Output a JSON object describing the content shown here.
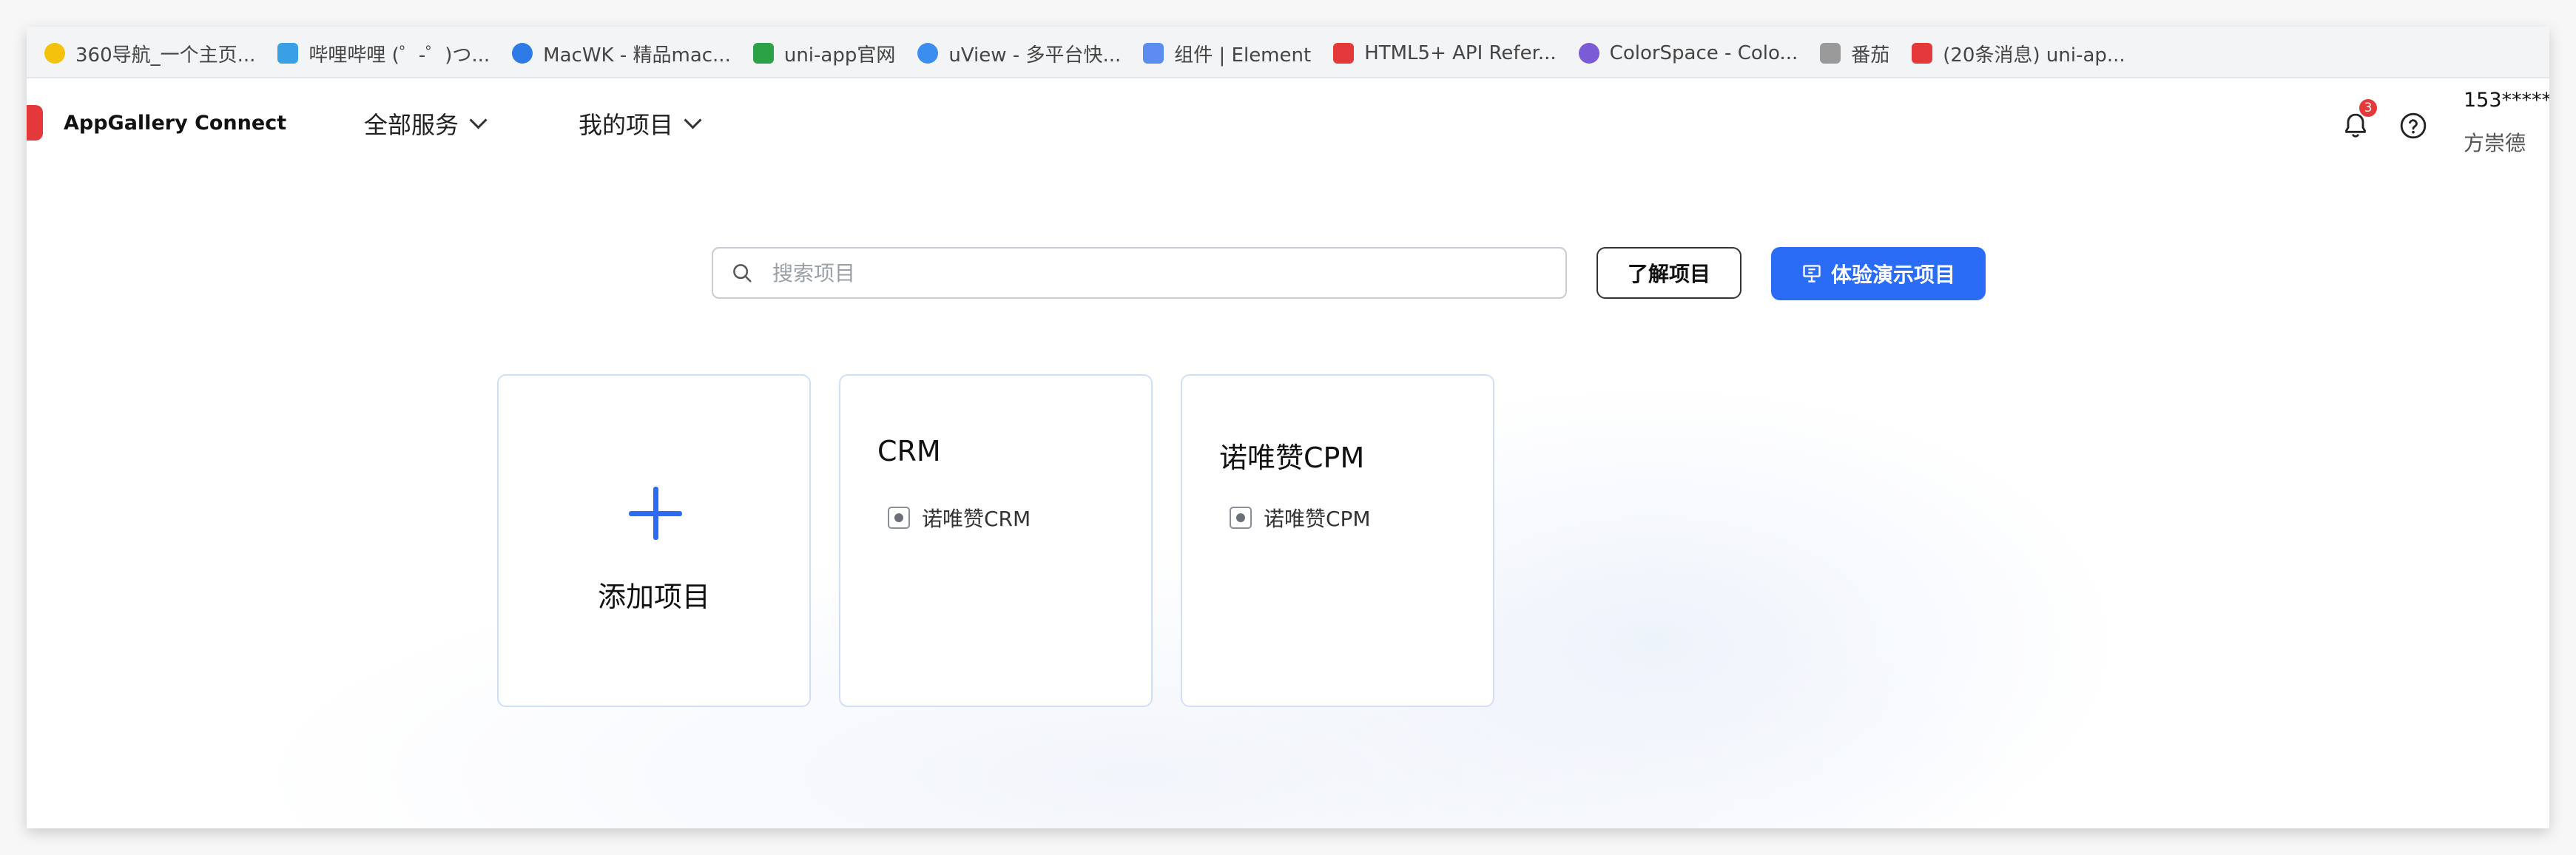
{
  "bookmarks": [
    {
      "label": "360导航_一个主页...",
      "color": "#f4c20d"
    },
    {
      "label": "哔哩哔哩 (゜-゜)つ...",
      "color": "#3aa0e6"
    },
    {
      "label": "MacWK - 精品mac...",
      "color": "#2e7be8"
    },
    {
      "label": "uni-app官网",
      "color": "#2ba245"
    },
    {
      "label": "uView - 多平台快...",
      "color": "#3b8df0"
    },
    {
      "label": "组件 | Element",
      "color": "#5b8def"
    },
    {
      "label": "HTML5+ API Refer...",
      "color": "#e5383b"
    },
    {
      "label": "ColorSpace - Colo...",
      "color": "#7b5bd6"
    },
    {
      "label": "番茄",
      "color": "#9a9a9a"
    },
    {
      "label": "(20条消息) uni-ap...",
      "color": "#e5383b"
    }
  ],
  "header": {
    "brand": "AppGallery Connect",
    "nav_all_services": "全部服务",
    "nav_my_projects": "我的项目",
    "notification_count": "3",
    "user_phone": "153*****",
    "user_name": "方崇德"
  },
  "toolbar": {
    "search_placeholder": "搜索项目",
    "learn_label": "了解项目",
    "demo_label": "体验演示项目"
  },
  "cards": {
    "add_label": "添加项目",
    "projects": [
      {
        "title": "CRM",
        "app": "诺唯赞CRM"
      },
      {
        "title": "诺唯赞CPM",
        "app": "诺唯赞CPM"
      }
    ]
  },
  "colors": {
    "accent": "#2a6cf6",
    "brand_red": "#e5383b",
    "card_border": "#cfe0f6"
  }
}
